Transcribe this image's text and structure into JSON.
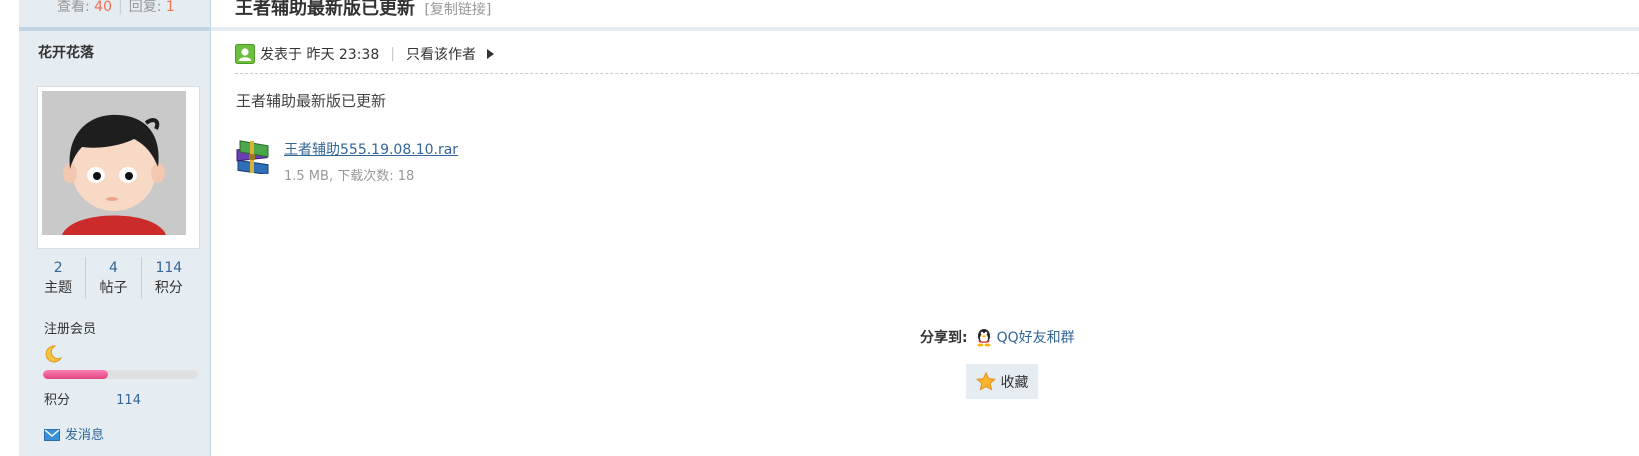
{
  "thread": {
    "views_label": "查看:",
    "views": "40",
    "replies_label": "回复:",
    "replies": "1",
    "title": "王者辅助最新版已更新",
    "copy_link": "[复制链接]"
  },
  "author": {
    "name": "花开花落",
    "stats": [
      {
        "value": "2",
        "label": "主题"
      },
      {
        "value": "4",
        "label": "帖子"
      },
      {
        "value": "114",
        "label": "积分"
      }
    ],
    "group": "注册会员",
    "level_progress": 0.42,
    "points_label": "积分",
    "points": "114",
    "send_message": "发消息"
  },
  "post": {
    "posted_at": "发表于 昨天 23:38",
    "author_only": "只看该作者",
    "body": "王者辅助最新版已更新",
    "attachment": {
      "name": "王者辅助555.19.08.10.rar",
      "info": "1.5 MB, 下载次数: 18",
      "icon": "rar-archive-icon"
    }
  },
  "share": {
    "label": "分享到:",
    "qq": "QQ好友和群"
  },
  "favorite": {
    "label": "收藏"
  },
  "colors": {
    "link": "#336699",
    "sidebar_bg": "#e5edf2",
    "count_highlight": "#f26c4f",
    "progress": "#e0457f"
  }
}
